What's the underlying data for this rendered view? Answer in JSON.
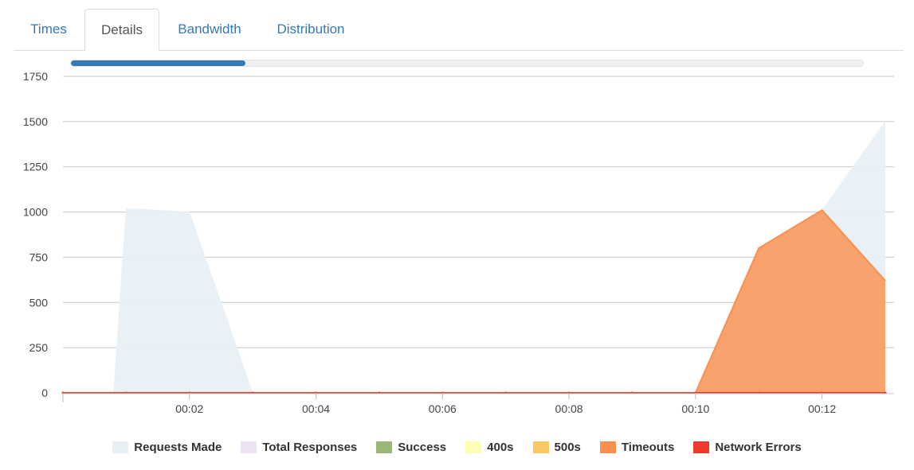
{
  "tabs": [
    {
      "label": "Times",
      "active": false
    },
    {
      "label": "Details",
      "active": true
    },
    {
      "label": "Bandwidth",
      "active": false
    },
    {
      "label": "Distribution",
      "active": false
    }
  ],
  "progress": {
    "value": 0.22
  },
  "colors": {
    "requests_made": "#e8f0f5",
    "total_responses": "#ece2f3",
    "success": "#9bb676",
    "s400": "#ffffb3",
    "s500": "#fdc861",
    "timeouts": "#fb8f4b",
    "network_errors": "#ee3a2c"
  },
  "chart_data": {
    "type": "area",
    "x": [
      "00:00",
      "00:01",
      "00:02",
      "00:03",
      "00:04",
      "00:05",
      "00:06",
      "00:07",
      "00:08",
      "00:09",
      "00:10",
      "00:11",
      "00:12",
      "00:13"
    ],
    "xticks": [
      "00:02",
      "00:04",
      "00:06",
      "00:08",
      "00:10",
      "00:12"
    ],
    "yticks": [
      "0",
      "250",
      "500",
      "750",
      "1000",
      "1250",
      "1500",
      "1750"
    ],
    "ylim": [
      0,
      1750
    ],
    "grid": true,
    "legend_position": "bottom",
    "series": [
      {
        "name": "Requests Made",
        "color_key": "requests_made",
        "x": [
          0,
          0.8,
          1,
          2,
          3,
          4,
          5,
          6,
          7,
          8,
          9,
          10,
          11,
          12,
          13
        ],
        "values": [
          0,
          0,
          1020,
          1000,
          0,
          0,
          0,
          0,
          0,
          0,
          0,
          0,
          800,
          1010,
          1500
        ]
      },
      {
        "name": "Total Responses",
        "color_key": "total_responses",
        "x": [
          0,
          13
        ],
        "values": [
          0,
          0
        ]
      },
      {
        "name": "Success",
        "color_key": "success",
        "x": [
          0,
          13
        ],
        "values": [
          0,
          0
        ]
      },
      {
        "name": "400s",
        "color_key": "s400",
        "x": [
          0,
          13
        ],
        "values": [
          0,
          0
        ]
      },
      {
        "name": "500s",
        "color_key": "s500",
        "x": [
          0,
          13
        ],
        "values": [
          0,
          0
        ]
      },
      {
        "name": "Timeouts",
        "color_key": "timeouts",
        "x": [
          0,
          1,
          2,
          3,
          4,
          5,
          6,
          7,
          8,
          9,
          10,
          11,
          12,
          13
        ],
        "values": [
          0,
          0,
          0,
          0,
          0,
          0,
          0,
          0,
          0,
          0,
          0,
          800,
          1010,
          620
        ]
      },
      {
        "name": "Network Errors",
        "color_key": "network_errors",
        "x": [
          0,
          1,
          2,
          3,
          4,
          5,
          6,
          7,
          8,
          9,
          10,
          11,
          12,
          13
        ],
        "values": [
          0,
          0,
          0,
          0,
          0,
          0,
          0,
          0,
          0,
          0,
          0,
          0,
          0,
          0
        ]
      }
    ]
  }
}
